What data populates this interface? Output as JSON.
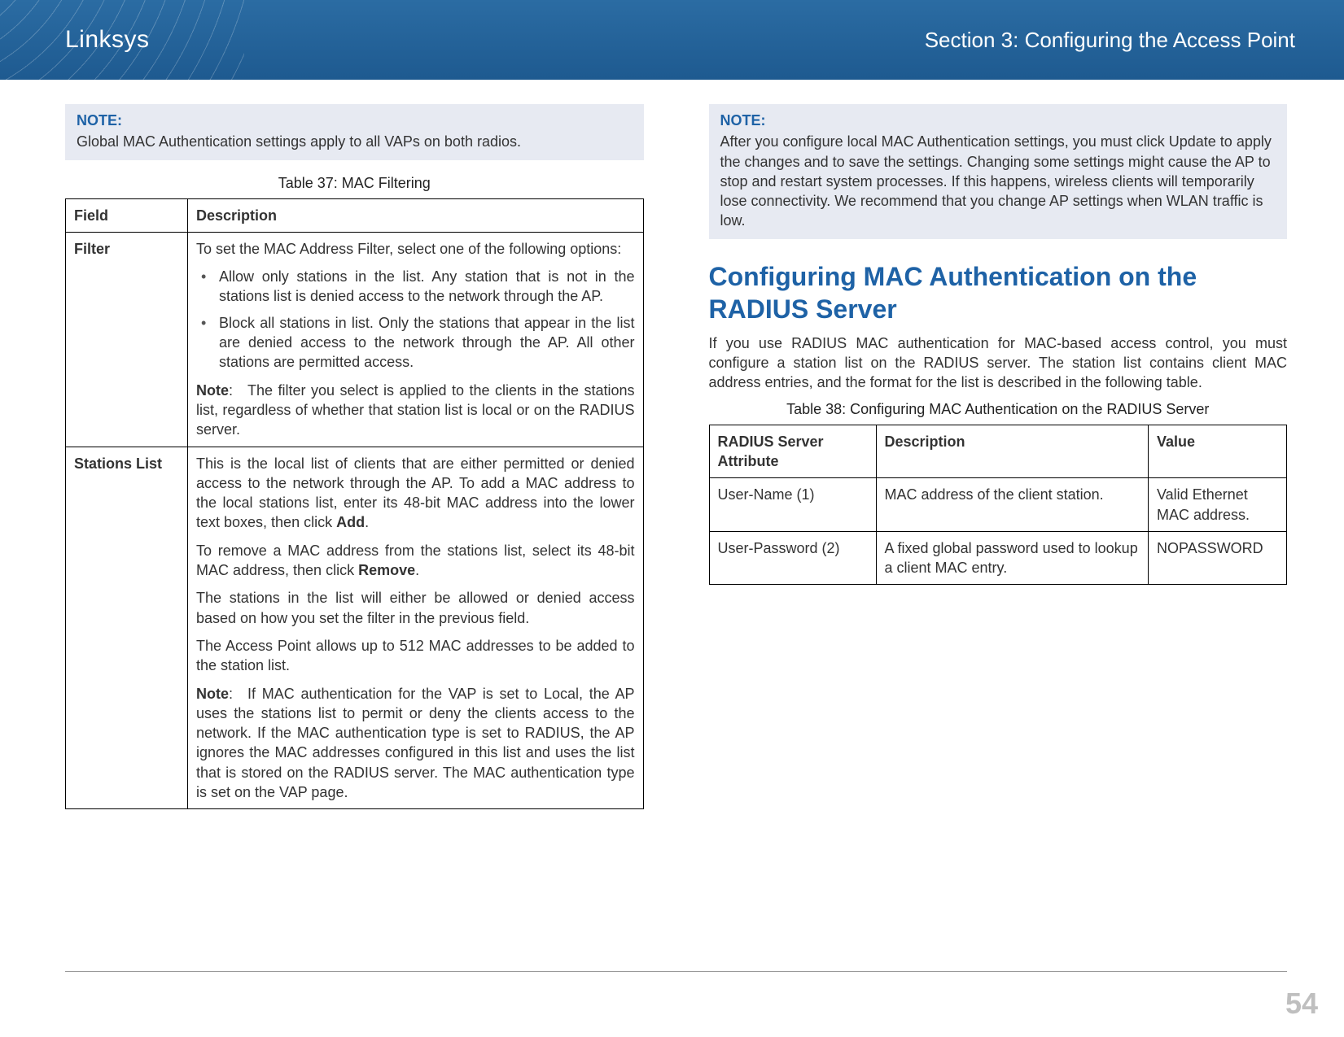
{
  "header": {
    "brand": "Linksys",
    "section": "Section 3:  Configuring the Access Point"
  },
  "left": {
    "note": {
      "label": "NOTE:",
      "text": "Global MAC Authentication settings apply to all VAPs on both radios."
    },
    "table37": {
      "caption": "Table 37: MAC Filtering",
      "head_field": "Field",
      "head_desc": "Description",
      "filter": {
        "label": "Filter",
        "intro": "To set the MAC Address Filter, select one of the following options:",
        "bullet1": "Allow only stations in the list. Any station that is not in the stations list is denied access to the network through the AP.",
        "bullet2": "Block all stations in list. Only the stations that appear in the list are denied access to the network through the AP. All other stations are permitted access.",
        "note_prefix": "Note",
        "note_body": ": The filter you select is applied to the clients in the stations list, regardless of whether that station list is local or on the RADIUS server."
      },
      "stations": {
        "label": "Stations List",
        "p1a": "This is the local list of clients that are either permitted or denied access to the network through the AP. To add a MAC address to the local stations list, enter its 48-bit MAC address into the lower text boxes, then click ",
        "p1b_bold": "Add",
        "p1c": ".",
        "p2a": "To remove a MAC address from the stations list, select its 48-bit MAC address, then click ",
        "p2b_bold": "Remove",
        "p2c": ".",
        "p3": "The stations in the list will either be allowed or denied access based on how you set the filter in the previous field.",
        "p4": "The Access Point allows up to 512 MAC addresses to be added to the station list.",
        "note_prefix": "Note",
        "note_body": ": If MAC authentication for the VAP is set to Local, the AP uses the stations list to permit or deny the clients access to the network. If the MAC authentication type is set to RADIUS, the AP ignores the MAC addresses configured in this list and uses the list that is stored on the RADIUS server. The MAC authentication type is set on the VAP page."
      }
    }
  },
  "right": {
    "note": {
      "label": "NOTE:",
      "text": "After you configure local MAC Authentication settings, you must click Update to apply the changes and to save the settings. Changing some settings might cause the AP to stop and restart system processes. If this happens, wireless clients will temporarily lose connectivity. We recommend that you change AP settings when WLAN traffic is low."
    },
    "h2": "Configuring MAC Authentication on the RADIUS Server",
    "para": "If you use RADIUS MAC authentication for MAC-based access control, you must configure a station list on the RADIUS server. The station list contains client MAC address entries, and the format for the list is described in the following table.",
    "table38": {
      "caption": "Table 38: Configuring MAC Authentication on the RADIUS Server",
      "head_attr": "RADIUS Server Attribute",
      "head_desc": "Description",
      "head_val": "Value",
      "rows": [
        {
          "attr": "User-Name (1)",
          "desc": "MAC address of the client station.",
          "val": "Valid Ethernet MAC address."
        },
        {
          "attr": "User-Password (2)",
          "desc": "A fixed global password used to lookup a client MAC entry.",
          "val": "NOPASSWORD"
        }
      ]
    }
  },
  "page_number": "54"
}
